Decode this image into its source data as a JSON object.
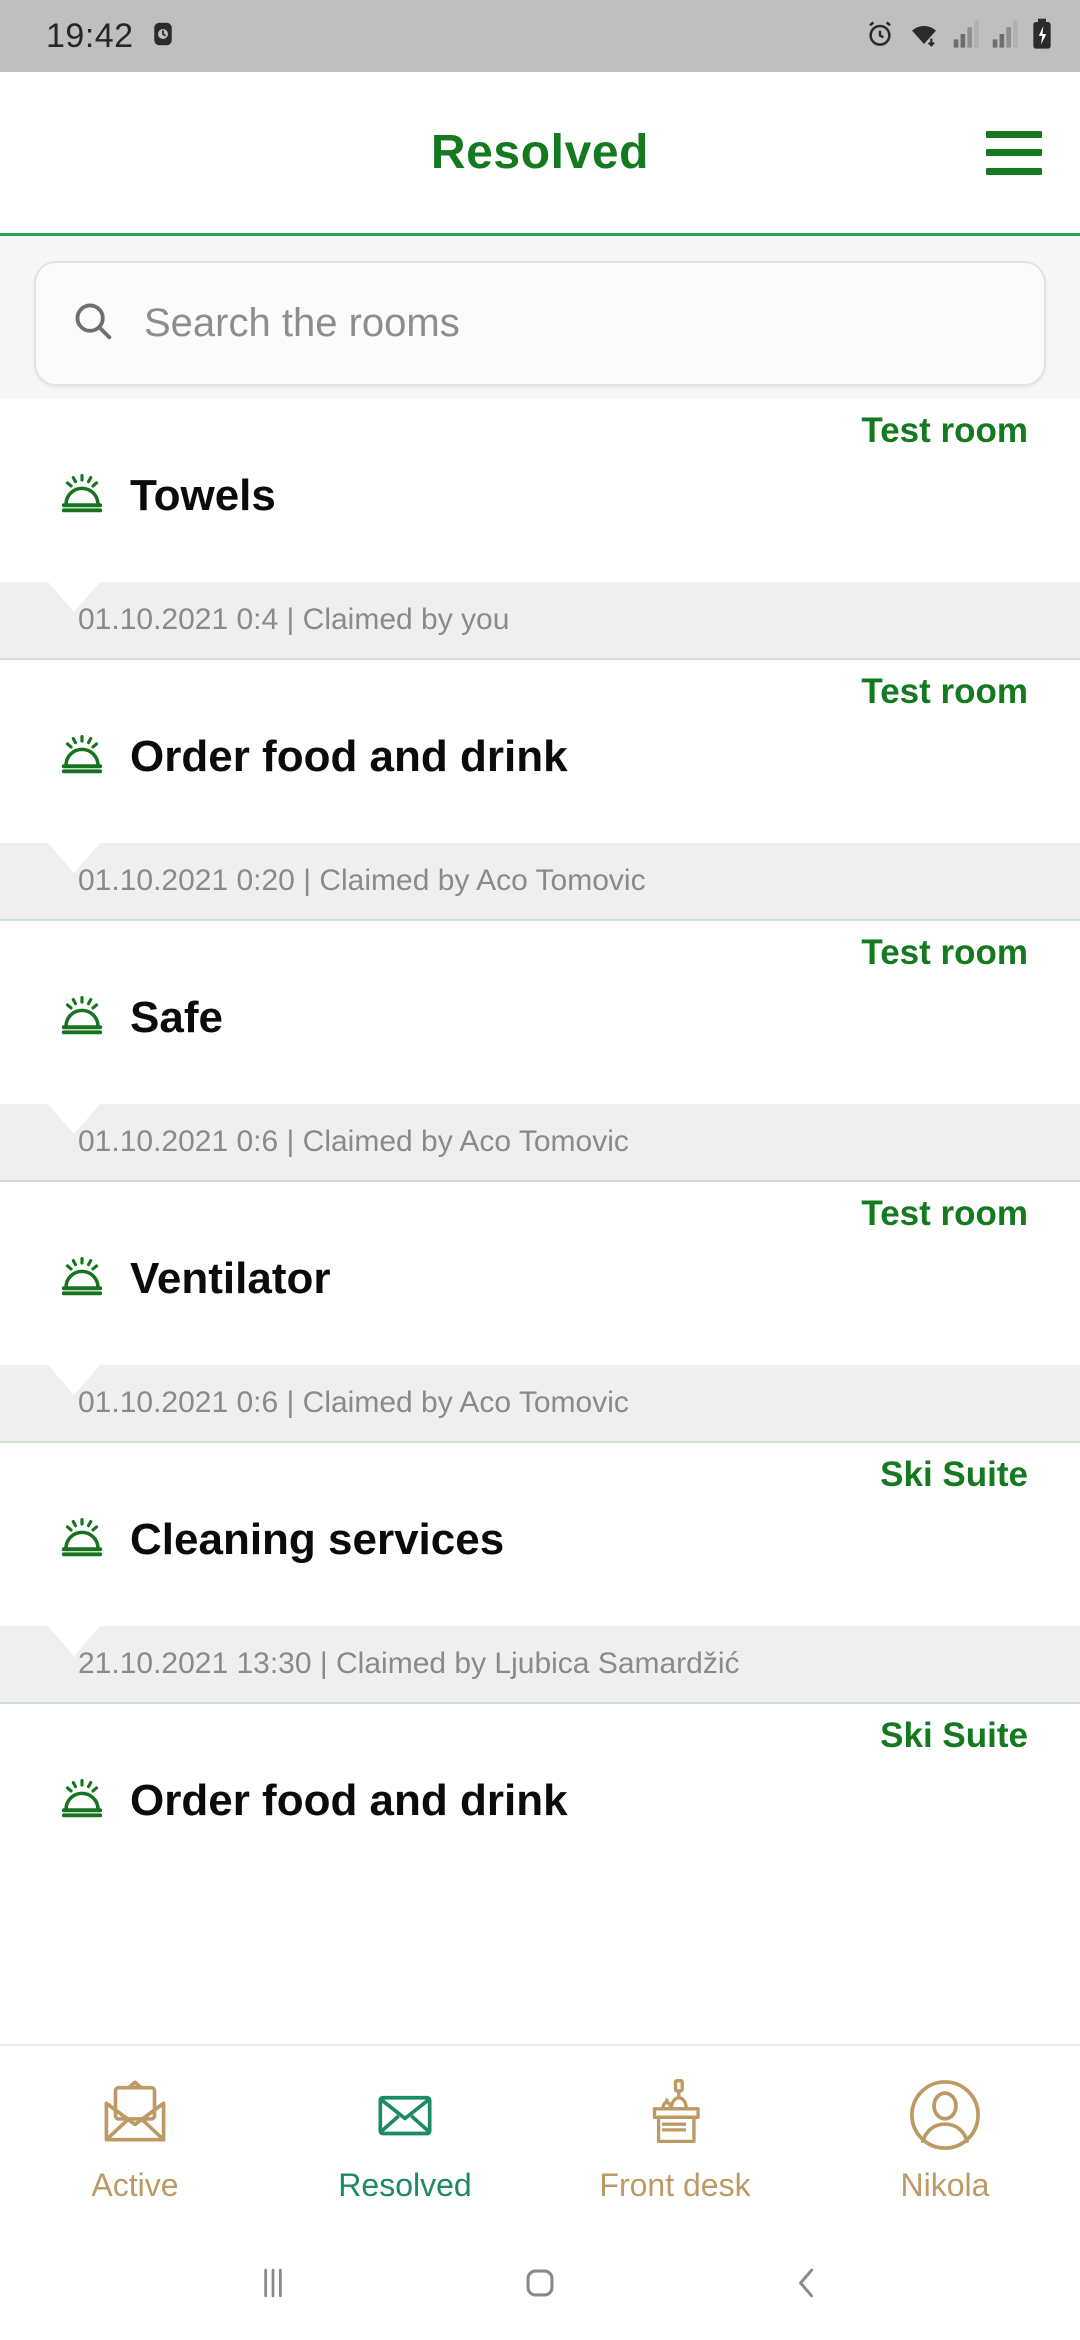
{
  "status_bar": {
    "time": "19:42",
    "icons": [
      "alarm-clock-icon",
      "wifi-icon",
      "signal-sim1-icon",
      "signal-sim2-icon",
      "battery-charging-icon"
    ]
  },
  "header": {
    "title": "Resolved",
    "menu_icon": "hamburger-menu-icon",
    "accent_color": "#15791f",
    "divider_color": "#2e9e5b"
  },
  "search": {
    "placeholder": "Search the rooms",
    "value": "",
    "icon": "search-icon"
  },
  "list": {
    "item_icon": "service-bell-icon",
    "items": [
      {
        "title": "Towels",
        "room": "Test room",
        "meta": "01.10.2021 0:4 | Claimed by you"
      },
      {
        "title": "Order food and drink",
        "room": "Test room",
        "meta": "01.10.2021 0:20 | Claimed by Aco Tomovic"
      },
      {
        "title": "Safe",
        "room": "Test room",
        "meta": "01.10.2021 0:6 | Claimed by Aco Tomovic"
      },
      {
        "title": "Ventilator",
        "room": "Test room",
        "meta": "01.10.2021 0:6 | Claimed by Aco Tomovic"
      },
      {
        "title": "Cleaning services",
        "room": "Ski Suite",
        "meta": "21.10.2021 13:30 | Claimed by Ljubica Samardžić"
      },
      {
        "title": "Order food and drink",
        "room": "Ski Suite",
        "meta": ""
      }
    ]
  },
  "tabbar": {
    "gold_color": "#bd9a63",
    "active_color": "#1d8a64",
    "tabs": [
      {
        "label": "Active",
        "icon": "open-envelope-icon",
        "active": false
      },
      {
        "label": "Resolved",
        "icon": "closed-envelope-icon",
        "active": true
      },
      {
        "label": "Front desk",
        "icon": "front-desk-icon",
        "active": false
      },
      {
        "label": "Nikola",
        "icon": "user-avatar-icon",
        "active": false
      }
    ]
  },
  "system_nav": {
    "recents_icon": "recents-icon",
    "home_icon": "home-icon",
    "back_icon": "back-icon"
  }
}
